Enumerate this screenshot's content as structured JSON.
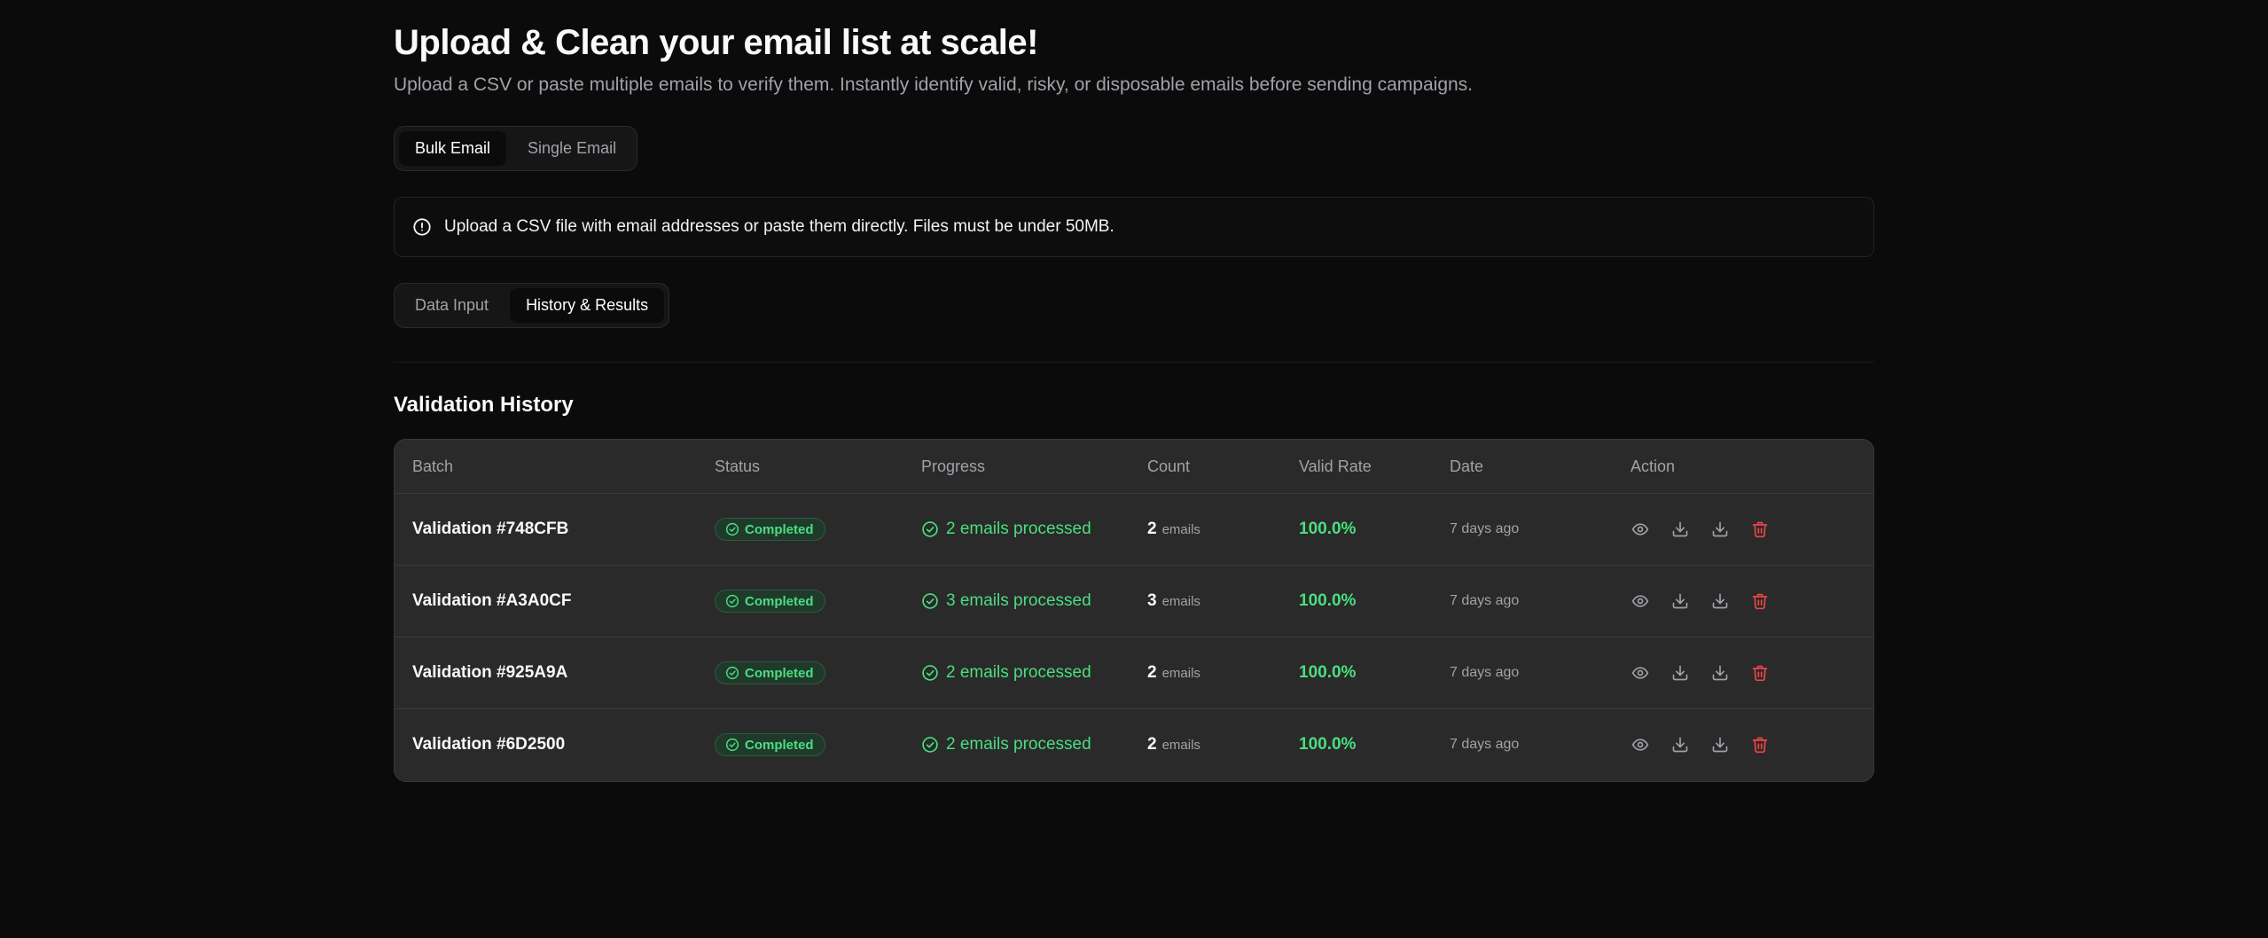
{
  "header": {
    "title": "Upload & Clean your email list at scale!",
    "subtitle": "Upload a CSV or paste multiple emails to verify them. Instantly identify valid, risky, or disposable emails before sending campaigns."
  },
  "mode_tabs": [
    {
      "label": "Bulk Email",
      "active": true
    },
    {
      "label": "Single Email",
      "active": false
    }
  ],
  "info": {
    "icon": "alert-circle-icon",
    "text": "Upload a CSV file with email addresses or paste them directly. Files must be under 50MB."
  },
  "view_tabs": [
    {
      "label": "Data Input",
      "active": false
    },
    {
      "label": "History & Results",
      "active": true
    }
  ],
  "history": {
    "title": "Validation History",
    "columns": [
      "Batch",
      "Status",
      "Progress",
      "Count",
      "Valid Rate",
      "Date",
      "Action"
    ],
    "rows": [
      {
        "batch": "Validation #748CFB",
        "status": "Completed",
        "progress": "2 emails processed",
        "count": "2",
        "count_unit": "emails",
        "valid_rate": "100.0%",
        "date": "7 days ago"
      },
      {
        "batch": "Validation #A3A0CF",
        "status": "Completed",
        "progress": "3 emails processed",
        "count": "3",
        "count_unit": "emails",
        "valid_rate": "100.0%",
        "date": "7 days ago"
      },
      {
        "batch": "Validation #925A9A",
        "status": "Completed",
        "progress": "2 emails processed",
        "count": "2",
        "count_unit": "emails",
        "valid_rate": "100.0%",
        "date": "7 days ago"
      },
      {
        "batch": "Validation #6D2500",
        "status": "Completed",
        "progress": "2 emails processed",
        "count": "2",
        "count_unit": "emails",
        "valid_rate": "100.0%",
        "date": "7 days ago"
      }
    ],
    "row_actions": [
      "eye-icon",
      "download-icon",
      "download-icon",
      "trash-icon"
    ]
  },
  "colors": {
    "background": "#0b0b0b",
    "card": "#2a2a2a",
    "success": "#4ade80",
    "danger": "#ef4444",
    "muted": "#a1a1aa"
  }
}
